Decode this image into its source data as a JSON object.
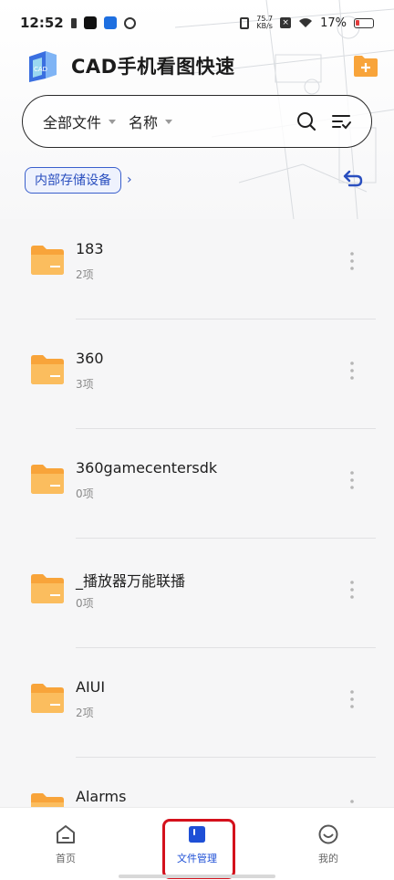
{
  "status_bar": {
    "time": "12:52",
    "net_speed_value": "75.7",
    "net_speed_unit": "KB/s",
    "battery_percent": "17%"
  },
  "app": {
    "title": "CAD手机看图快速"
  },
  "filter": {
    "type_label": "全部文件",
    "sort_label": "名称"
  },
  "path": {
    "current": "内部存储设备"
  },
  "files": [
    {
      "name": "183",
      "count": "2项"
    },
    {
      "name": "360",
      "count": "3项"
    },
    {
      "name": "360gamecentersdk",
      "count": "0项"
    },
    {
      "name": "_播放器万能联播",
      "count": "0项"
    },
    {
      "name": "AIUI",
      "count": "2项"
    },
    {
      "name": "Alarms",
      "count": ""
    }
  ],
  "nav": {
    "home": "首页",
    "files": "文件管理",
    "mine": "我的"
  },
  "colors": {
    "accent": "#1e4fd6",
    "folder": "#f8a43a",
    "highlight": "#d4111c"
  }
}
